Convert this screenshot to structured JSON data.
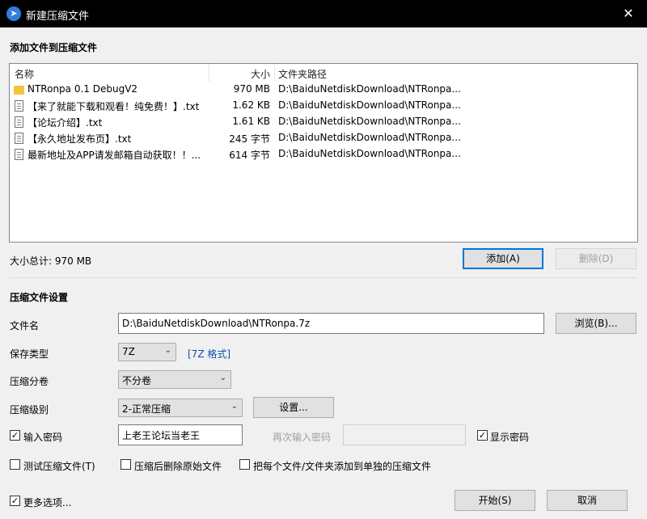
{
  "window": {
    "title": "新建压缩文件",
    "close_glyph": "✕",
    "app_icon": "arrow-app-icon"
  },
  "sections": {
    "add_files": "添加文件到压缩文件",
    "settings": "压缩文件设置"
  },
  "filelist": {
    "headers": {
      "name": "名称",
      "size": "大小",
      "path": "文件夹路径"
    },
    "rows": [
      {
        "icon": "folder-icon",
        "name": "NTRonpa 0.1 DebugV2",
        "size": "970 MB",
        "path": "D:\\BaiduNetdiskDownload\\NTRonpa..."
      },
      {
        "icon": "file-icon",
        "name": "【来了就能下载和观看！纯免费！】.txt",
        "size": "1.62 KB",
        "path": "D:\\BaiduNetdiskDownload\\NTRonpa..."
      },
      {
        "icon": "file-icon",
        "name": "【论坛介绍】.txt",
        "size": "1.61 KB",
        "path": "D:\\BaiduNetdiskDownload\\NTRonpa..."
      },
      {
        "icon": "file-icon",
        "name": "【永久地址发布页】.txt",
        "size": "245 字节",
        "path": "D:\\BaiduNetdiskDownload\\NTRonpa..."
      },
      {
        "icon": "file-icon",
        "name": "最新地址及APP请发邮箱自动获取！！...",
        "size": "614 字节",
        "path": "D:\\BaiduNetdiskDownload\\NTRonpa..."
      }
    ]
  },
  "total_size": "大小总计: 970 MB",
  "buttons": {
    "add": "添加(A)",
    "delete": "删除(D)",
    "browse": "浏览(B)...",
    "settings": "设置...",
    "start": "开始(S)",
    "cancel": "取消"
  },
  "form": {
    "filename_label": "文件名",
    "filename_value": "D:\\BaiduNetdiskDownload\\NTRonpa.7z",
    "save_type_label": "保存类型",
    "save_type_value": "7Z",
    "save_type_link": "[7Z 格式]",
    "split_label": "压缩分卷",
    "split_value": "不分卷",
    "level_label": "压缩级别",
    "level_value": "2-正常压缩",
    "password_label": "输入密码",
    "password_checked": true,
    "password_value": "上老王论坛当老王",
    "repeat_password_label": "再次输入密码",
    "repeat_password_value": "",
    "show_password_label": "显示密码",
    "show_password_checked": true,
    "test_label": "测试压缩文件(T)",
    "test_checked": false,
    "delete_after_label": "压缩后删除原始文件",
    "delete_after_checked": false,
    "separate_label": "把每个文件/文件夹添加到单独的压缩文件",
    "separate_checked": false,
    "more_options_label": "更多选项...",
    "more_options_checked": true
  },
  "check_glyph": "✓",
  "chevron_glyph": "⌄"
}
